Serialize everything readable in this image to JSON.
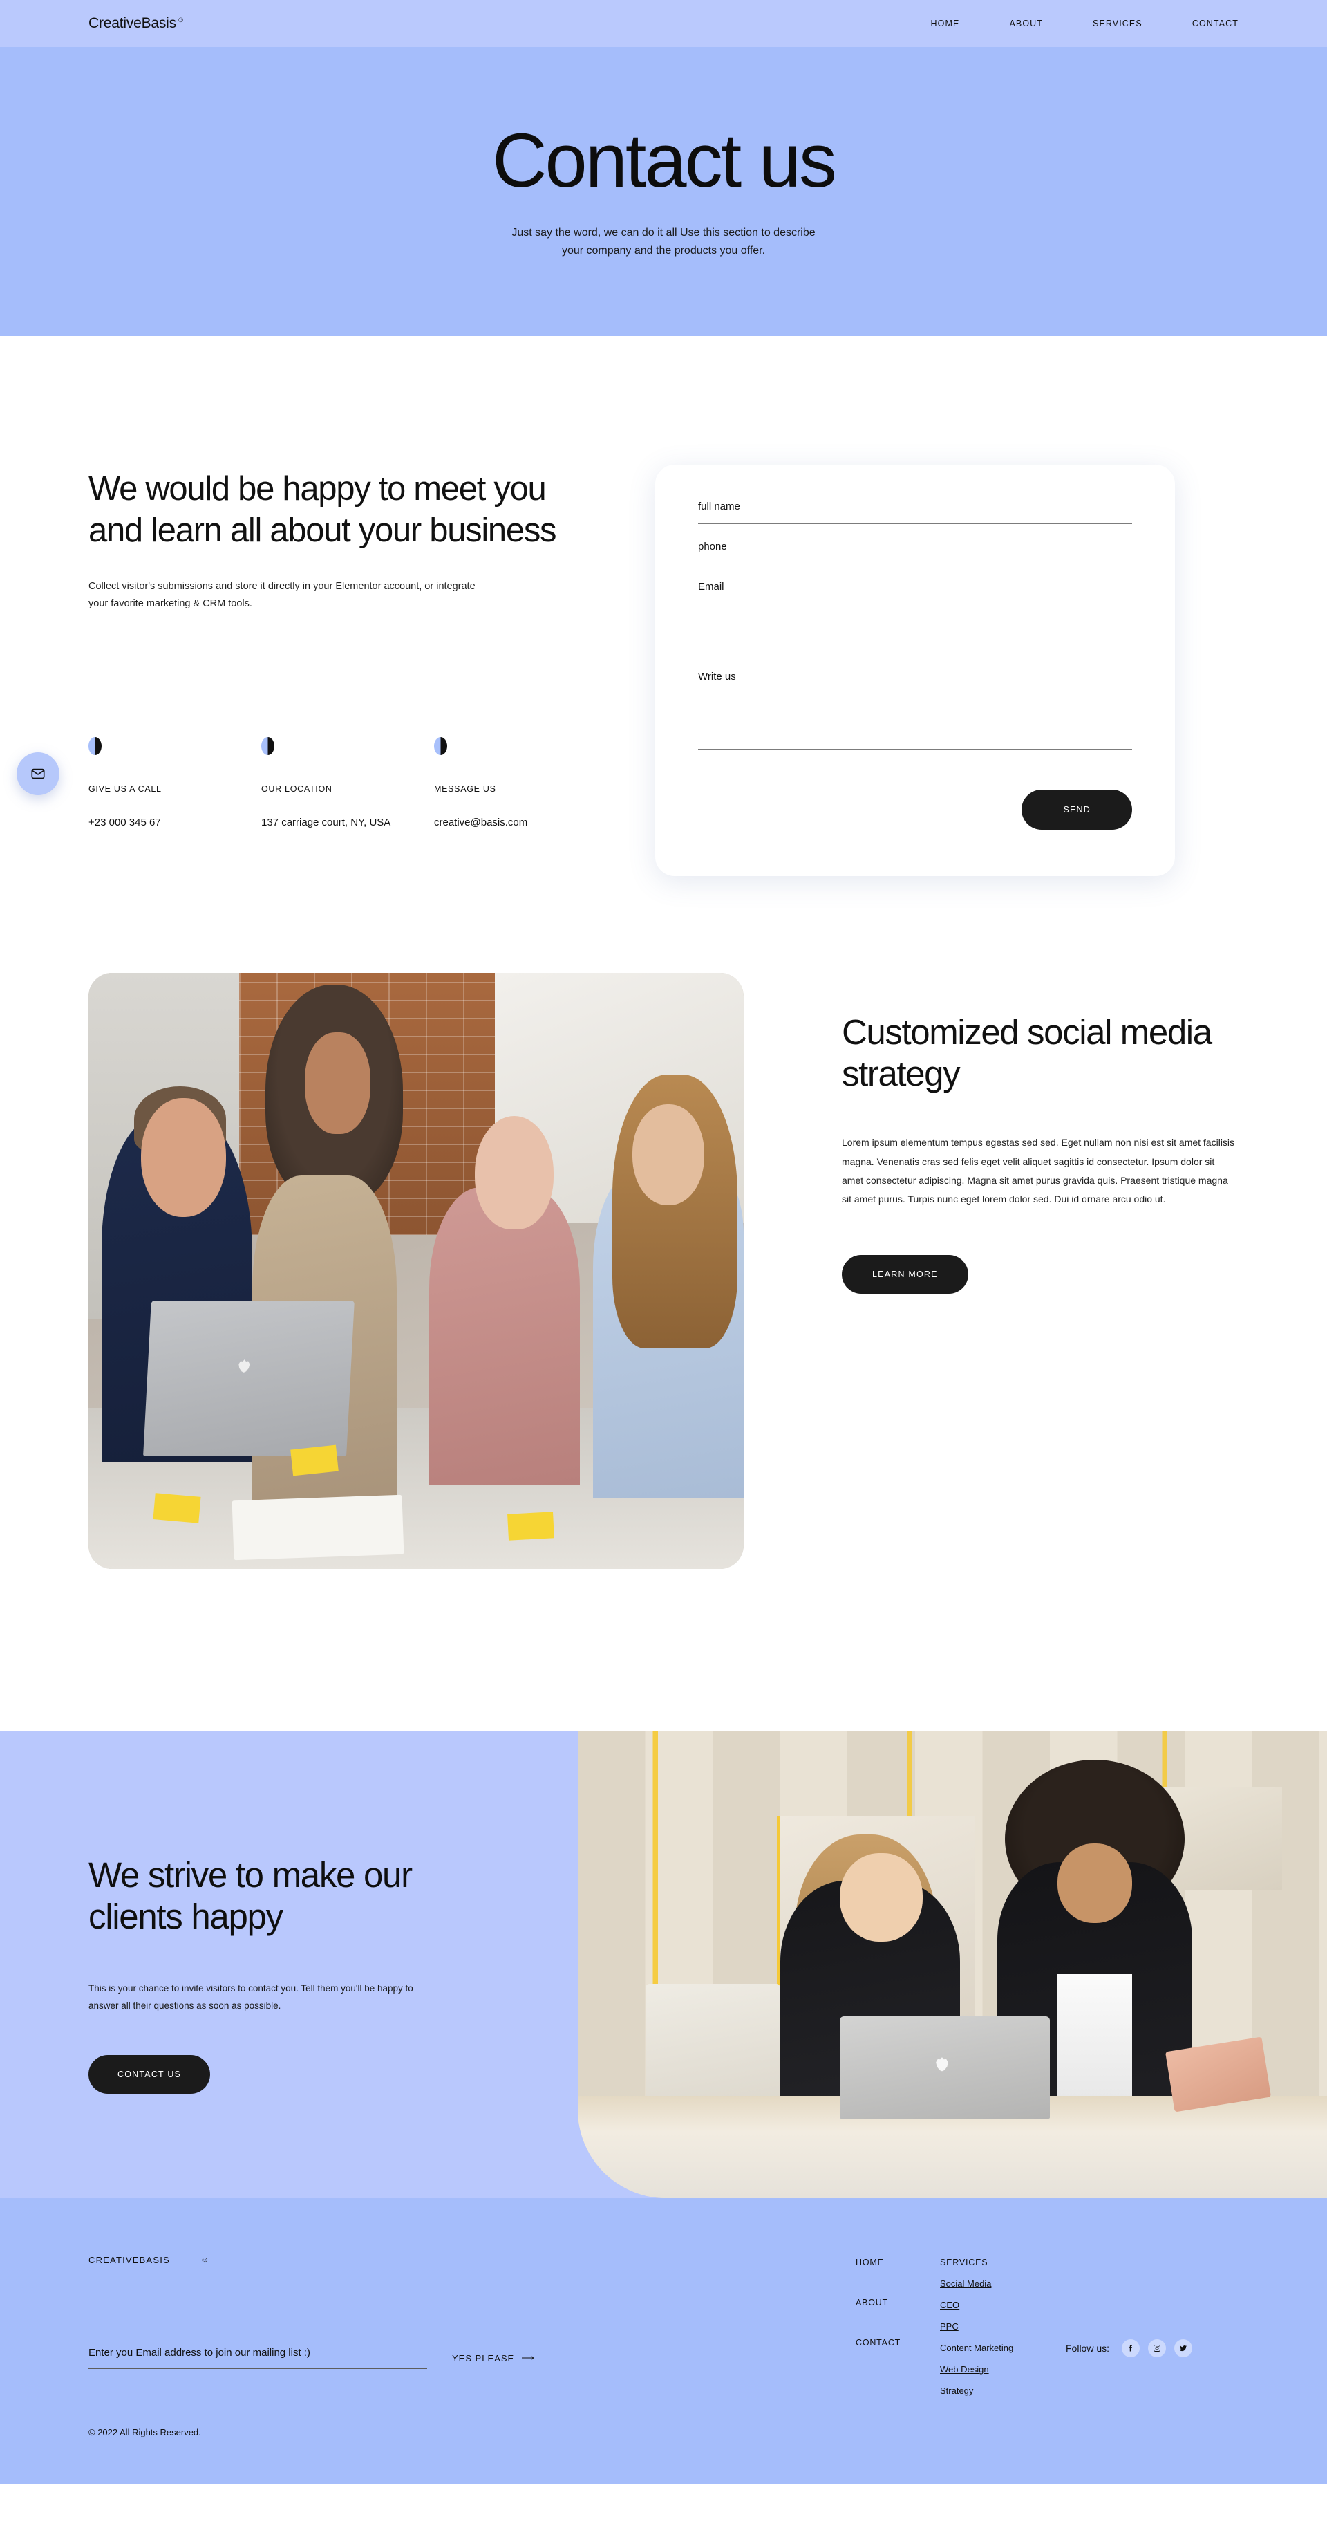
{
  "header": {
    "logo": "CreativeBasis",
    "logo_mark": "☺",
    "nav": [
      {
        "label": "HOME"
      },
      {
        "label": "ABOUT"
      },
      {
        "label": "SERVICES"
      },
      {
        "label": "CONTACT"
      }
    ]
  },
  "hero": {
    "title": "Contact us",
    "subtitle": "Just say the word, we can do it all Use this section to describe your company and the products you offer."
  },
  "fab": {
    "icon": "mail-icon"
  },
  "contact": {
    "heading": "We would be happy to meet you and learn all about your business",
    "description": "Collect visitor's submissions and store it directly in your Elementor account, or integrate your favorite marketing & CRM tools.",
    "info": [
      {
        "icon": "phone-icon",
        "label": "GIVE US A CALL",
        "value": "+23 000 345 67"
      },
      {
        "icon": "location-icon",
        "label": "OUR LOCATION",
        "value": "137 carriage court, NY, USA"
      },
      {
        "icon": "mail-icon",
        "label": "MESSAGE US",
        "value": "creative@basis.com"
      }
    ],
    "form": {
      "fields": [
        {
          "name": "full-name",
          "placeholder": "full name",
          "value": ""
        },
        {
          "name": "phone",
          "placeholder": "phone",
          "value": ""
        },
        {
          "name": "email",
          "placeholder": "Email",
          "value": ""
        },
        {
          "name": "message",
          "placeholder": "Write us",
          "value": ""
        }
      ],
      "submit_label": "SEND"
    }
  },
  "strategy": {
    "image_alt": "team-meeting-photo",
    "heading": "Customized social media strategy",
    "body": "Lorem ipsum elementum tempus egestas sed sed. Eget nullam non nisi est sit amet facilisis magna. Venenatis cras sed felis eget velit aliquet sagittis id consectetur. Ipsum dolor sit amet consectetur adipiscing. Magna sit amet purus gravida quis. Praesent tristique magna sit amet purus. Turpis nunc eget lorem dolor sed. Dui id ornare arcu odio ut.",
    "cta_label": "LEARN MORE"
  },
  "strive": {
    "heading": "We strive to make our clients happy",
    "body": "This is your chance to invite visitors to contact you. Tell them you'll be happy to answer all their questions as soon as possible.",
    "cta_label": "CONTACT US",
    "image_alt": "office-reception-photo"
  },
  "footer": {
    "brand": "CREATIVEBASIS",
    "brand_mark": "☺",
    "newsletter": {
      "placeholder": "Enter you Email address to join our mailing list :)",
      "value": "",
      "cta_label": "YES PLEASE",
      "cta_arrow": "⟶"
    },
    "copyright": "© 2022 All Rights Reserved.",
    "pages": [
      {
        "label": "HOME"
      },
      {
        "label": "ABOUT"
      },
      {
        "label": "CONTACT"
      }
    ],
    "services_heading": "SERVICES",
    "services": [
      {
        "label": "Social Media"
      },
      {
        "label": "CEO"
      },
      {
        "label": "PPC"
      },
      {
        "label": "Content Marketing"
      },
      {
        "label": "Web Design"
      },
      {
        "label": "Strategy"
      }
    ],
    "follow_label": "Follow us:",
    "socials": [
      {
        "name": "facebook-icon"
      },
      {
        "name": "instagram-icon"
      },
      {
        "name": "twitter-icon"
      }
    ]
  },
  "colors": {
    "periwinkle": "#a5bdfb",
    "periwinkle_light": "#bac9fd",
    "dark": "#1b1b1b",
    "white": "#ffffff"
  }
}
